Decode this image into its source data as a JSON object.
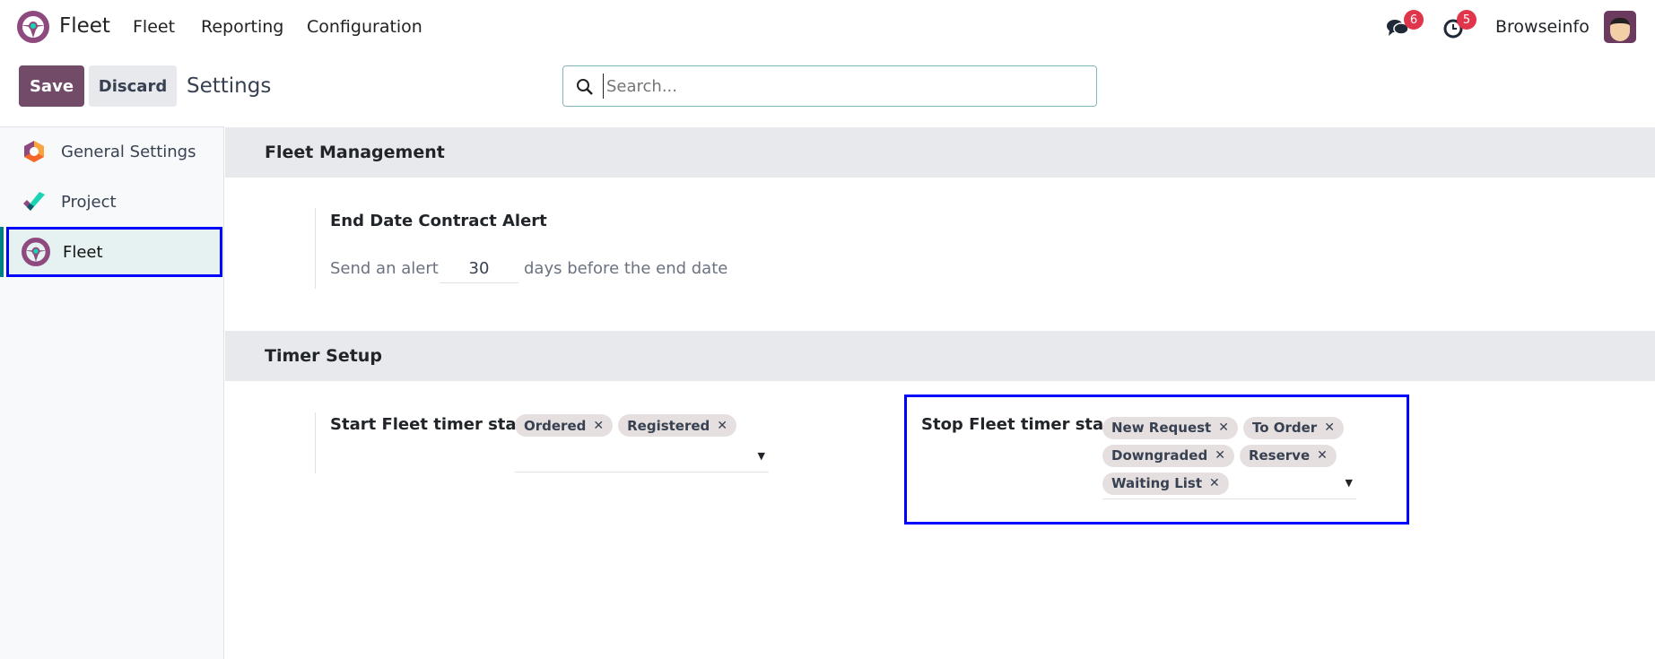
{
  "nav": {
    "app_name": "Fleet",
    "menu": [
      "Fleet",
      "Reporting",
      "Configuration"
    ],
    "messages_count": "6",
    "activities_count": "5",
    "user_name": "Browseinfo"
  },
  "control": {
    "save_label": "Save",
    "discard_label": "Discard",
    "breadcrumb": "Settings",
    "search_placeholder": "Search..."
  },
  "sidebar": {
    "items": [
      {
        "label": "General Settings"
      },
      {
        "label": "Project"
      },
      {
        "label": "Fleet"
      }
    ]
  },
  "sections": {
    "fleet_management": {
      "title": "Fleet Management",
      "setting_title": "End Date Contract Alert",
      "prefix": "Send an alert",
      "value": "30",
      "suffix": "days before the end date"
    },
    "timer_setup": {
      "title": "Timer Setup",
      "start_label": "Start Fleet timer stage",
      "start_tags": [
        "Ordered",
        "Registered"
      ],
      "stop_label": "Stop Fleet timer stage",
      "stop_tags": [
        "New Request",
        "To Order",
        "Downgraded",
        "Reserve",
        "Waiting List"
      ]
    }
  },
  "colors": {
    "primary": "#714B67",
    "highlight": "#0000ff"
  }
}
